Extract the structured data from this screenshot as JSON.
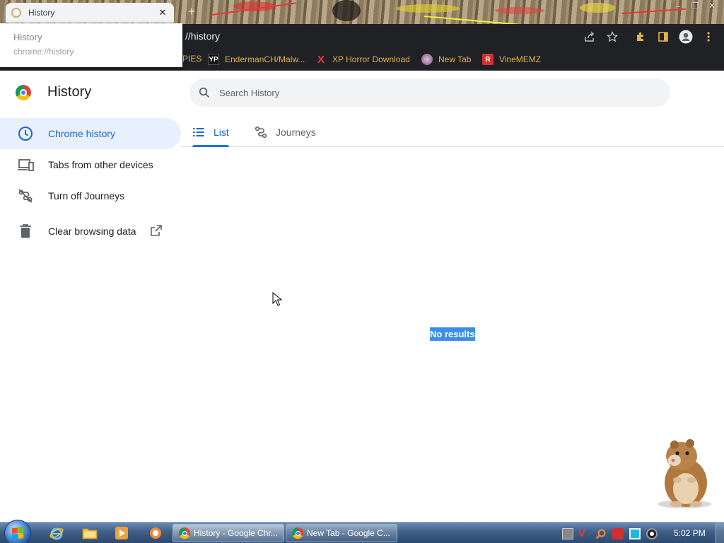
{
  "browser": {
    "tab": {
      "title": "History"
    },
    "hover_card": {
      "title": "History",
      "url": "chrome://history"
    },
    "omnibox": {
      "prefix": "",
      "path": "//history"
    },
    "bookmarks": [
      {
        "label": "PIES",
        "icon": "bookmark-icon"
      },
      {
        "label": "EndermanCH/Malw...",
        "icon": "yp-icon"
      },
      {
        "label": "XP Horror Download",
        "icon": "x-icon"
      },
      {
        "label": "New Tab",
        "icon": "globe-icon"
      },
      {
        "label": "VineMEMZ",
        "icon": "r-icon"
      }
    ],
    "window_controls": {
      "minimize": "–",
      "maximize": "❐",
      "close": "✕"
    }
  },
  "history_page": {
    "title": "History",
    "search_placeholder": "Search History",
    "sidebar": [
      {
        "label": "Chrome history",
        "icon": "clock-icon",
        "active": true
      },
      {
        "label": "Tabs from other devices",
        "icon": "devices-icon"
      },
      {
        "label": "Turn off Journeys",
        "icon": "journeys-off-icon"
      },
      {
        "label": "Clear browsing data",
        "icon": "trash-icon"
      }
    ],
    "tabs": [
      {
        "label": "List",
        "icon": "list-icon",
        "selected": true
      },
      {
        "label": "Journeys",
        "icon": "journeys-icon",
        "selected": false
      }
    ],
    "empty_state": "No results"
  },
  "taskbar": {
    "tasks": [
      {
        "label": "History - Google Chr...",
        "active": true
      },
      {
        "label": "New Tab - Google C...",
        "active": false
      }
    ],
    "clock": "5:02 PM"
  },
  "colors": {
    "accent": "#1a73e8",
    "active_bg": "#e8f0fe",
    "toolbar": "#202124",
    "bookmark_text": "#e0b24e"
  }
}
